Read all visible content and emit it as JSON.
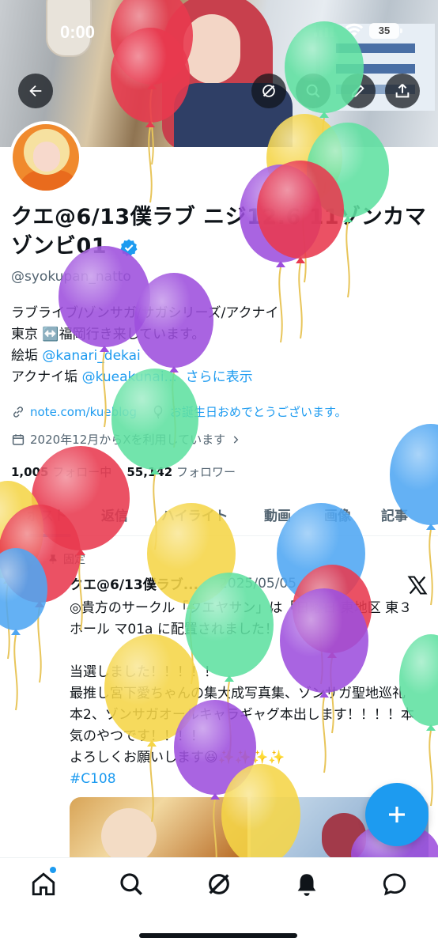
{
  "status_bar": {
    "time": "0:00",
    "battery": "35"
  },
  "header": {
    "back_icon": "arrow-left-icon",
    "grok_icon": "grok-icon",
    "search_icon": "search-icon",
    "edit_icon": "pencil-icon",
    "share_icon": "share-icon"
  },
  "profile": {
    "display_name": "クエ@6/13僕ラブ ニジ12.6 11ゾンカマ ゾンビ01",
    "handle": "@syokupan_natto",
    "bio_lines": [
      "ラブライブ/ゾンサガ/サガシリーズ/アクナイ",
      "東京 ↔️福岡行き来しています。"
    ],
    "bio_label_painter": "絵垢",
    "bio_painter_link": "@kanari_dekai",
    "bio_label_aknai": "アクナイ垢",
    "bio_aknai_link": "@kueakunai...",
    "show_more": "さらに表示",
    "website": "note.com/kueblog",
    "birthday": "お誕生日おめでとうございます。",
    "joined": "2020年12月からXを利用しています",
    "following_count": "1,005",
    "following_label": "フォロー中",
    "followers_count": "55,142",
    "followers_label": "フォロワー"
  },
  "tabs": [
    "ポスト",
    "返信",
    "ハイライト",
    "動画",
    "画像",
    "記事"
  ],
  "pinned_tweet": {
    "pinned_label": "固定",
    "author": "クエ@6/13僕ラブ...",
    "date": "2025/05/05",
    "body": "◎貴方のサークル「クエヤサン」は「日曜日 東地区 東３ホール マ01a に配置されました！\n\n当選しました！！！！！\n最推し宮下愛ちゃんの集大成写真集、ゾンサガ聖地巡礼本2、ゾンサガオールキャラギャグ本出します！！！！本気のやつです！！！！\nよろしくお願いします😆✨✨✨✨",
    "hashtag": "#C108"
  },
  "bottom_nav": [
    "home-icon",
    "search-icon",
    "grok-icon",
    "notifications-icon",
    "messages-icon"
  ],
  "colors": {
    "accent": "#1d9bf0",
    "text": "#0f1419",
    "muted": "#536471",
    "balloon_red": "#e8394f",
    "balloon_green": "#5fe0a0",
    "balloon_purple": "#9d4edd",
    "balloon_yellow": "#f5d547",
    "balloon_blue": "#4ea6f2"
  }
}
